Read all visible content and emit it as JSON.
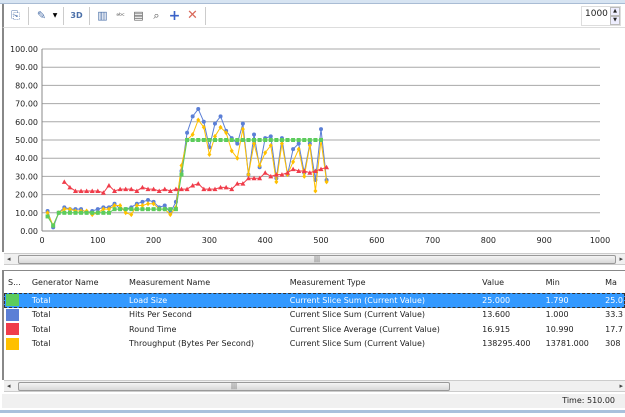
{
  "toolbar": {
    "icons": [
      "copy-icon",
      "highlight-icon",
      "dropdown-arrow-icon",
      "3d-zoom-icon",
      "chart-properties-icon",
      "legend-font-icon",
      "table-edit-icon",
      "zoom-search-icon",
      "add-icon",
      "delete-icon"
    ],
    "zoom_value": "1000"
  },
  "chart_data": {
    "type": "line",
    "xlim": [
      0,
      1000
    ],
    "ylim": [
      0,
      100
    ],
    "x_ticks": [
      "0",
      "100",
      "200",
      "300",
      "400",
      "500",
      "600",
      "700",
      "800",
      "900",
      "1000"
    ],
    "y_ticks": [
      "0.00",
      "10.00",
      "20.00",
      "30.00",
      "40.00",
      "50.00",
      "60.00",
      "70.00",
      "80.00",
      "90.00",
      "100.00"
    ],
    "grid": true,
    "series": [
      {
        "name": "Load Size",
        "color": "#5ccc5c",
        "marker": "square",
        "x_start": 10,
        "x_step": 10,
        "values": [
          8,
          3,
          10,
          10,
          10,
          10,
          10,
          10,
          10,
          10,
          10,
          10,
          12,
          12,
          12,
          12,
          12,
          12,
          12,
          12,
          12,
          12,
          12,
          12,
          31,
          50,
          50,
          50,
          50,
          50,
          50,
          50,
          50,
          50,
          50,
          50,
          50,
          50,
          50,
          50,
          50,
          50,
          50,
          50,
          50,
          50,
          50,
          50,
          50,
          50
        ]
      },
      {
        "name": "Hits Per Second",
        "color": "#5b7fd6",
        "marker": "circle",
        "x_start": 10,
        "x_step": 10,
        "values": [
          11,
          2,
          10,
          13,
          12,
          12,
          12,
          10,
          11,
          12,
          13,
          13,
          15,
          12,
          12,
          13,
          15,
          16,
          17,
          16,
          13,
          14,
          10,
          16,
          33,
          54,
          63,
          67,
          60,
          46,
          59,
          63,
          55,
          51,
          48,
          59,
          31,
          53,
          35,
          51,
          52,
          29,
          51,
          31,
          45,
          48,
          32,
          48,
          28,
          56,
          28
        ]
      },
      {
        "name": "Round Time",
        "color": "#f03c4a",
        "marker": "triangle",
        "x_start": 40,
        "x_step": 10,
        "values": [
          27,
          24,
          22,
          22,
          22,
          22,
          22,
          21,
          25,
          22,
          23,
          23,
          23,
          22,
          24,
          23,
          23,
          22,
          23,
          22,
          23,
          23,
          23,
          25,
          26,
          23,
          23,
          23,
          24,
          24,
          23,
          26,
          26,
          29,
          29,
          29,
          32,
          30,
          31,
          31,
          32,
          34,
          33,
          33,
          32,
          33,
          34,
          35
        ]
      }
    ]
  },
  "chart_series_extra": {
    "round_time_values": [
      27,
      24,
      22,
      22,
      22,
      22,
      22,
      21,
      25,
      22,
      23,
      23,
      23,
      22,
      24,
      23,
      23,
      22,
      23,
      22,
      23,
      23,
      23,
      25,
      26,
      23,
      23,
      23,
      24,
      24,
      23,
      26,
      26,
      29,
      29,
      29,
      32,
      30,
      31,
      31,
      32,
      34,
      33,
      33,
      32,
      33,
      34,
      35
    ],
    "throughput": {
      "name": "Throughput (Bytes Per Second)",
      "color": "#ffc000",
      "marker": "diamond",
      "x_start": 10,
      "x_step": 10,
      "values": [
        10,
        3,
        10,
        12,
        12,
        11,
        11,
        11,
        9,
        10,
        12,
        12,
        14,
        14,
        10,
        9,
        14,
        14,
        15,
        15,
        12,
        12,
        9,
        13,
        36,
        50,
        53,
        61,
        57,
        42,
        52,
        57,
        54,
        44,
        40,
        56,
        31,
        48,
        36,
        43,
        47,
        27,
        48,
        31,
        38,
        45,
        30,
        47,
        22,
        50,
        27
      ]
    }
  },
  "grid": {
    "headers": [
      "S...",
      "Generator Name",
      "Measurement Name",
      "Measurement Type",
      "Value",
      "Min",
      "Ma"
    ],
    "rows": [
      {
        "color": "#5ccc5c",
        "generator": "Total",
        "name": "Load Size",
        "type": "Current Slice Sum (Current Value)",
        "value": "25.000",
        "min": "1.790",
        "max": "25.0"
      },
      {
        "color": "#5b7fd6",
        "generator": "Total",
        "name": "Hits Per Second",
        "type": "Current Slice Sum (Current Value)",
        "value": "13.600",
        "min": "1.000",
        "max": "33.3"
      },
      {
        "color": "#f03c4a",
        "generator": "Total",
        "name": "Round Time",
        "type": "Current Slice Average (Current Value)",
        "value": "16.915",
        "min": "10.990",
        "max": "17.7"
      },
      {
        "color": "#ffc000",
        "generator": "Total",
        "name": "Throughput (Bytes Per Second)",
        "type": "Current Slice Sum (Current Value)",
        "value": "138295.400",
        "min": "13781.000",
        "max": "308"
      }
    ]
  },
  "status": {
    "time": "Time: 510.00"
  }
}
